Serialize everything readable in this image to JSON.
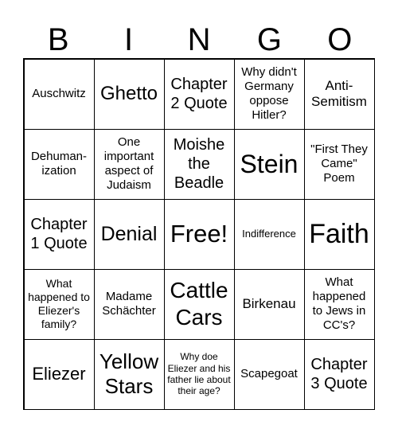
{
  "header": [
    "B",
    "I",
    "N",
    "G",
    "O"
  ],
  "cells": [
    {
      "text": "Auschwitz",
      "size": 15
    },
    {
      "text": "Ghetto",
      "size": 24
    },
    {
      "text": "Chapter 2 Quote",
      "size": 20
    },
    {
      "text": "Why didn't Germany oppose Hitler?",
      "size": 15
    },
    {
      "text": "Anti-Semitism",
      "size": 17
    },
    {
      "text": "Dehuman-ization",
      "size": 15
    },
    {
      "text": "One important aspect of Judaism",
      "size": 15
    },
    {
      "text": "Moishe the Beadle",
      "size": 20
    },
    {
      "text": "Stein",
      "size": 32
    },
    {
      "text": "\"First They Came\" Poem",
      "size": 15
    },
    {
      "text": "Chapter 1 Quote",
      "size": 20
    },
    {
      "text": "Denial",
      "size": 25
    },
    {
      "text": "Free!",
      "size": 31
    },
    {
      "text": "Indifference",
      "size": 13
    },
    {
      "text": "Faith",
      "size": 34
    },
    {
      "text": "What happened to Eliezer's family?",
      "size": 14
    },
    {
      "text": "Madame Schächter",
      "size": 15
    },
    {
      "text": "Cattle Cars",
      "size": 28
    },
    {
      "text": "Birkenau",
      "size": 17
    },
    {
      "text": "What happened to Jews in CC's?",
      "size": 15
    },
    {
      "text": "Eliezer",
      "size": 22
    },
    {
      "text": "Yellow Stars",
      "size": 26
    },
    {
      "text": "Why doe Eliezer and his father lie about their age?",
      "size": 12
    },
    {
      "text": "Scapegoat",
      "size": 15
    },
    {
      "text": "Chapter 3 Quote",
      "size": 20
    }
  ]
}
